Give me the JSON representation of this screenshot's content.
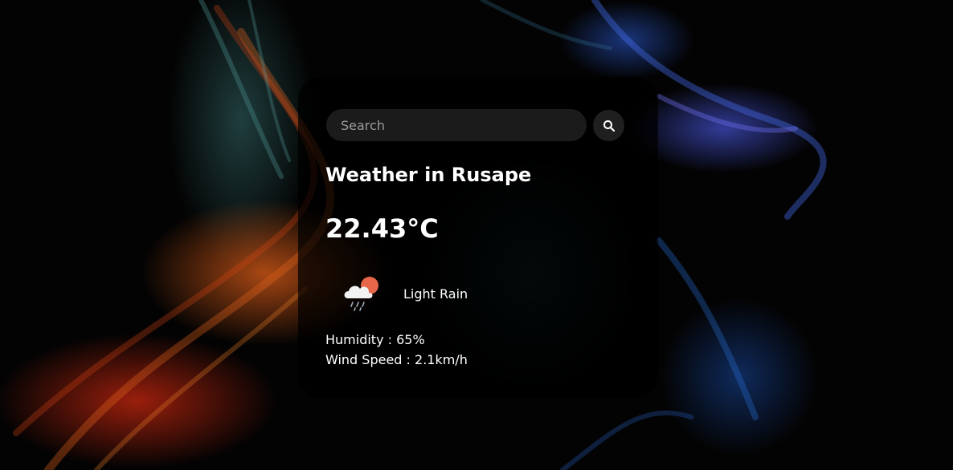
{
  "search": {
    "placeholder": "Search",
    "value": ""
  },
  "weather": {
    "title": "Weather in Rusape",
    "temperature": "22.43°C",
    "condition": "Light Rain",
    "condition_icon": "cloud-rain-sun-icon",
    "humidity": "Humidity : 65%",
    "wind": "Wind Speed : 2.1km/h"
  },
  "colors": {
    "card_background": "#000000b8",
    "text": "#ffffff",
    "search_background": "#7d7d7d38",
    "sun": "#e8664a"
  },
  "icons": {
    "search_button": "search-icon"
  }
}
